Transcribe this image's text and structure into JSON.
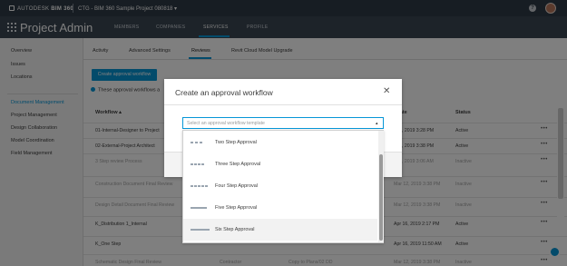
{
  "topbar": {
    "brand": "AUTODESK",
    "product": "BIM 360",
    "project": "CTG - BIM 360 Sample Project 080818 ▾",
    "help": "?"
  },
  "header": {
    "title": "Project Admin",
    "tabs": [
      "MEMBERS",
      "COMPANIES",
      "SERVICES",
      "PROFILE"
    ],
    "active_tab": "SERVICES"
  },
  "sidebar": {
    "items": [
      "Overview",
      "Issues",
      "Locations"
    ],
    "section": "Document Management",
    "sub_items": [
      "Project Management",
      "Design Collaboration",
      "Model Coordination",
      "Field Management"
    ]
  },
  "subtabs": {
    "items": [
      "Activity",
      "Advanced Settings",
      "Reviews",
      "Revit Cloud Model Upgrade"
    ],
    "active": "Reviews"
  },
  "main": {
    "create_button": "Create approval workflow",
    "info_text": "These approval workflows a",
    "columns": [
      "Workflow ▴",
      "pdate",
      "Status"
    ],
    "rows": [
      {
        "name": "01-Internal-Designer to Project",
        "date": "r 12, 2019 3:28 PM",
        "status": "Active",
        "inactive": false
      },
      {
        "name": "02-External-Project Architect",
        "date": "r 12, 2019 3:38 PM",
        "status": "Active",
        "inactive": false
      },
      {
        "name": "3 Step review Process",
        "date": "r 12, 2019 3:06 AM",
        "status": "Inactive",
        "inactive": true
      },
      {
        "name": "Construction Document Final Review",
        "date": "Mar 12, 2019 3:38 PM",
        "status": "Inactive",
        "inactive": true
      },
      {
        "name": "Design Detail Document Final Review",
        "date": "Mar 12, 2019 3:38 PM",
        "status": "Inactive",
        "inactive": true
      },
      {
        "name": "K_Distribution 1_Internal",
        "date": "Apr 16, 2019 2:17 PM",
        "status": "Active",
        "inactive": false
      },
      {
        "name": "K_One Step",
        "date": "Apr 16, 2019 11:50 AM",
        "status": "Active",
        "inactive": false
      },
      {
        "name": "Schematic Design Final Review",
        "date": "Mar 12, 2019 3:38 PM",
        "status": "Inactive",
        "inactive": true
      }
    ],
    "partial_rows": [
      {
        "col": "Contractor",
        "col2": "Copy to Plans/02 DD"
      }
    ],
    "more_glyph": "•••"
  },
  "modal": {
    "title": "Create an approval workflow",
    "close": "✕",
    "select_placeholder": "Select an approval workflow template",
    "caret": "▴",
    "options": [
      "Two Step Approval",
      "Three Step Approval",
      "Four Step Approval",
      "Five Step Approval",
      "Six Step Approval"
    ],
    "hovered_option": "Six Step Approval"
  },
  "colors": {
    "accent": "#0696d7",
    "topbar": "#2f3a46",
    "header": "#3b4753"
  }
}
